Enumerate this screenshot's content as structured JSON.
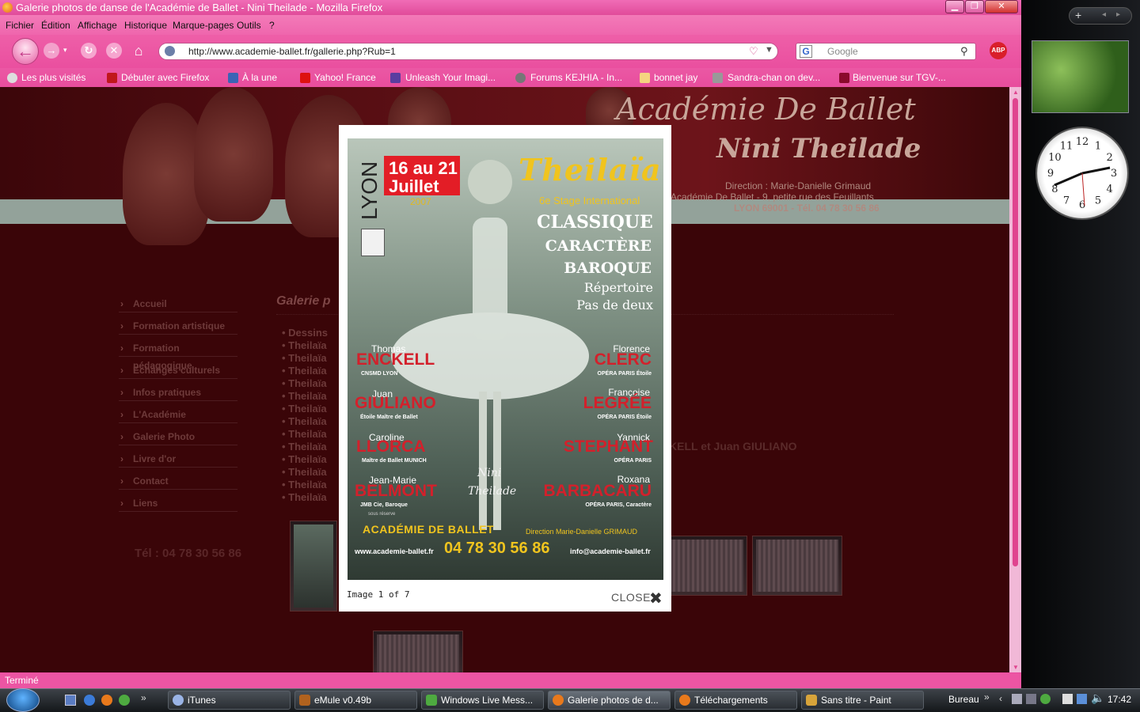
{
  "window": {
    "title": "Galerie photos de danse de l'Académie de Ballet - Nini Theilade - Mozilla Firefox",
    "controls": {
      "minimize": "▁",
      "maximize": "❐",
      "close": "✕"
    }
  },
  "menu": [
    "Fichier",
    "Édition",
    "Affichage",
    "Historique",
    "Marque-pages",
    "Outils",
    "?"
  ],
  "nav": {
    "url": "http://www.academie-ballet.fr/gallerie.php?Rub=1",
    "search_placeholder": "Google",
    "abp_label": "ABP"
  },
  "bookmarks": [
    "Les plus visités",
    "Débuter avec Firefox",
    "À la une",
    "Yahoo! France",
    "Unleash Your Imagi...",
    "Forums KEJHIA - In...",
    "bonnet jay",
    "Sandra-chan on dev...",
    "Bienvenue sur TGV-..."
  ],
  "site": {
    "title_line1": "Académie De Ballet",
    "title_line2": "Nini Theilade",
    "address": [
      "Direction : Marie-Danielle Grimaud",
      "Académie De Ballet - 9, petite rue des Feuillants",
      "LYON 69001 - Tél. 04 78 30 56 86"
    ],
    "menu_items": [
      "Accueil",
      "Formation artistique",
      "Formation pédagogique",
      "Echanges culturels",
      "Infos pratiques",
      "L'Académie",
      "Galerie Photo",
      "Livre d'or",
      "Contact",
      "Liens"
    ],
    "tel": "Tél : 04 78 30 56 86",
    "gallery_title": "Galerie p",
    "gallery_items": [
      "Dessins",
      "Theilaïa",
      "Theilaïa",
      "Theilaïa",
      "Theilaïa",
      "Theilaïa",
      "Theilaïa",
      "Theilaïa",
      "Theilaïa",
      "Theilaïa",
      "Theilaïa",
      "Theilaïa",
      "Theilaïa",
      "Theilaïa"
    ],
    "gallery_extra": "KELL et Juan GIULIANO"
  },
  "lightbox": {
    "caption": "Image 1 of 7",
    "close_label": "CLOSE",
    "poster": {
      "city": "LYON",
      "date_line1": "16 au 21",
      "date_line2": "Juillet",
      "year": "2007",
      "event": "Theilaïa",
      "subtitle": "6e Stage International",
      "disciplines": [
        "CLASSIQUE",
        "CARACTÈRE",
        "BAROQUE",
        "Répertoire",
        "Pas de deux"
      ],
      "teachers_left": [
        {
          "first": "Thomas",
          "last": "ENCKELL",
          "role": "CNSMD LYON"
        },
        {
          "first": "Juan",
          "last": "GIULIANO",
          "role": "Étoile Maître de Ballet"
        },
        {
          "first": "Caroline",
          "last": "LLORCA",
          "role": "Maître de Ballet MUNICH"
        },
        {
          "first": "Jean-Marie",
          "last": "BELMONT",
          "role": "JMB Cie, Baroque"
        }
      ],
      "teachers_right": [
        {
          "first": "Florence",
          "last": "CLERC",
          "role": "OPÉRA PARIS Étoile"
        },
        {
          "first": "Françoise",
          "last": "LEGRÉE",
          "role": "OPÉRA PARIS Étoile"
        },
        {
          "first": "Yannick",
          "last": "STEPHANT",
          "role": "OPÉRA PARIS"
        },
        {
          "first": "Roxana",
          "last": "BARBACARU",
          "role": "OPÉRA PARIS, Caractère"
        }
      ],
      "reserve_note": "sous réserve",
      "signature_line1": "Nini",
      "signature_line2": "Theilade",
      "academy": "ACADÉMIE DE BALLET",
      "direction": "Direction Marie-Danielle GRIMAUD",
      "website": "www.academie-ballet.fr",
      "phone": "04 78 30 56 86",
      "email": "info@academie-ballet.fr"
    }
  },
  "status": "Terminé",
  "taskbar": {
    "items": [
      "iTunes",
      "eMule v0.49b",
      "Windows Live Mess...",
      "Galerie photos de d...",
      "Téléchargements",
      "Sans titre - Paint"
    ],
    "bureau": "Bureau",
    "time": "17:42"
  },
  "sidebar": {
    "add": "+",
    "prev": "◂",
    "next": "▸"
  },
  "clock_numbers": [
    "12",
    "1",
    "2",
    "3",
    "4",
    "5",
    "6",
    "7",
    "8",
    "9",
    "10",
    "11"
  ]
}
